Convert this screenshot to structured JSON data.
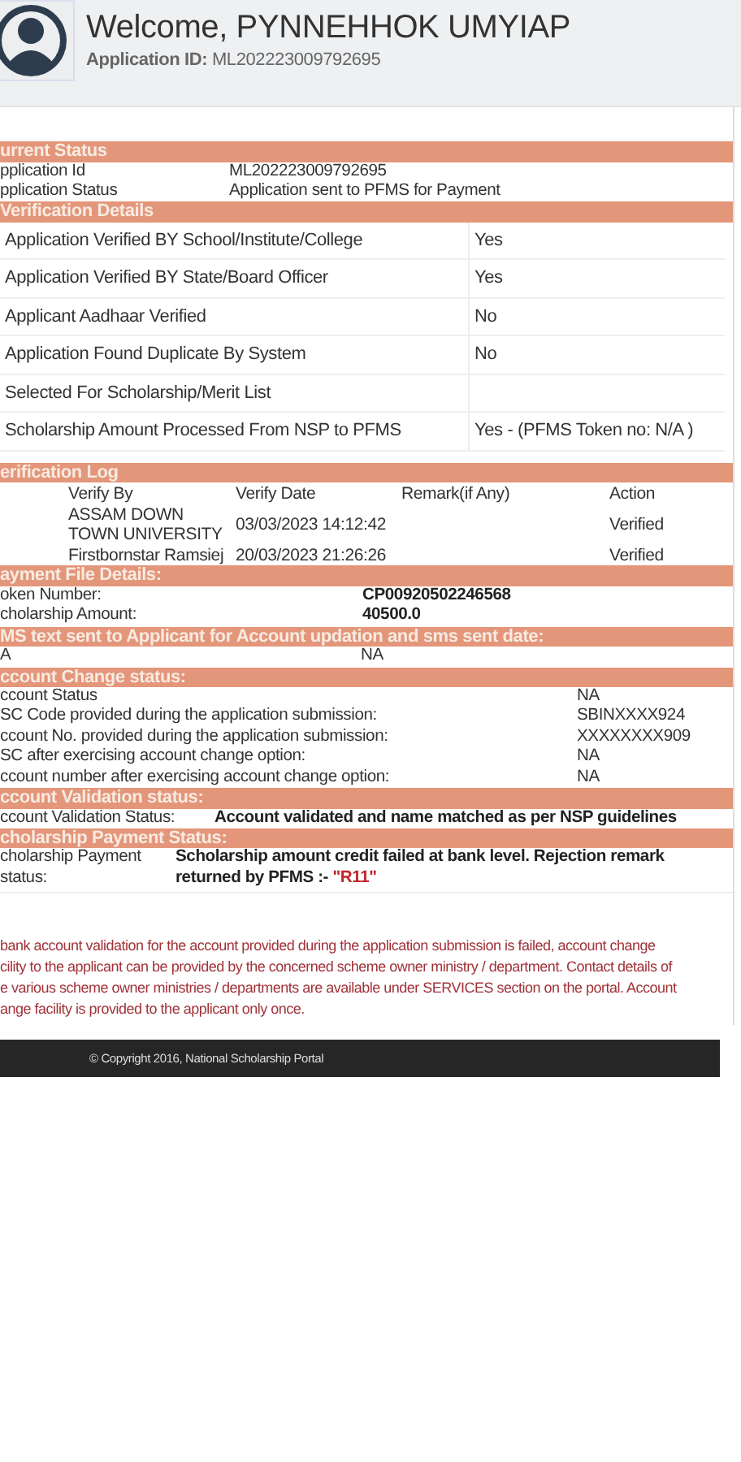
{
  "header": {
    "welcome": "Welcome, PYNNEHHOK UMYIAP",
    "app_id_label": "Application ID:",
    "app_id": "ML202223009792695"
  },
  "sections": [
    {
      "kind": "status",
      "title": "urrent Status",
      "rows": [
        {
          "label": "pplication Id",
          "value": "ML202223009792695"
        },
        {
          "label": "pplication Status",
          "value": "Application sent to PFMS for Payment"
        }
      ]
    },
    {
      "kind": "details",
      "title": "Verification Details",
      "rows": [
        {
          "label": "Application Verified BY School/Institute/College",
          "value": "Yes"
        },
        {
          "label": "Application Verified BY State/Board Officer",
          "value": "Yes"
        },
        {
          "label": "Applicant Aadhaar Verified",
          "value": "No"
        },
        {
          "label": "Application Found Duplicate By System",
          "value": "No"
        },
        {
          "label": "Selected For Scholarship/Merit List"
        },
        {
          "label": "Scholarship Amount Processed From NSP to PFMS",
          "value": "Yes - (PFMS Token no: N/A )"
        }
      ]
    },
    {
      "kind": "log",
      "title": "erification Log",
      "columns": [
        "Verify By",
        "Verify Date",
        "Remark(if Any)",
        "Action"
      ],
      "rows": [
        {
          "verify_by": "ASSAM DOWN TOWN UNIVERSITY",
          "verify_date": "03/03/2023 14:12:42",
          "action": "Verified"
        },
        {
          "verify_by": "Firstbornstar Ramsiej",
          "verify_date": "20/03/2023 21:26:26",
          "action": "Verified"
        }
      ]
    },
    {
      "kind": "file",
      "title": "ayment File Details:",
      "rows": [
        {
          "label": "oken Number:",
          "value": "CP00920502246568"
        },
        {
          "label": "cholarship Amount:",
          "value": "40500.0"
        }
      ]
    },
    {
      "kind": "sms",
      "title": "MS text sent to Applicant for Account updation and sms sent date:",
      "rows": [
        {
          "label": "A",
          "value": "NA"
        }
      ]
    },
    {
      "kind": "change",
      "title": "ccount Change status:",
      "rows": [
        {
          "label": "ccount Status",
          "value": "NA"
        },
        {
          "label": "SC Code provided during the application submission:",
          "value": "SBINXXXX924"
        },
        {
          "label": "ccount No. provided during the application submission:",
          "value": "XXXXXXXX909"
        },
        {
          "label": "SC after exercising account change option:",
          "value": "NA"
        },
        {
          "label": "ccount number after exercising account change option:",
          "value": "NA"
        }
      ]
    },
    {
      "kind": "validation",
      "title": "ccount Validation status:",
      "rows": [
        {
          "label": "ccount Validation Status:",
          "value": "Account validated and name matched as per NSP guidelines"
        }
      ]
    },
    {
      "kind": "payment",
      "title": "cholarship Payment Status:",
      "rows": [
        {
          "label": "cholarship Payment status:",
          "value": "Scholarship amount credit failed at bank level. Rejection remark returned by PFMS :- ",
          "code": "\"R11\""
        }
      ]
    }
  ],
  "notice": [
    "bank account validation for the account provided during the application submission is failed, account change",
    "cility to the applicant can be provided by the concerned scheme owner ministry / department. Contact details of",
    "e various scheme owner ministries / departments are available under SERVICES section on the portal. Account",
    "ange facility is provided to the applicant only once."
  ],
  "footer": "© Copyright 2016, National Scholarship Portal"
}
